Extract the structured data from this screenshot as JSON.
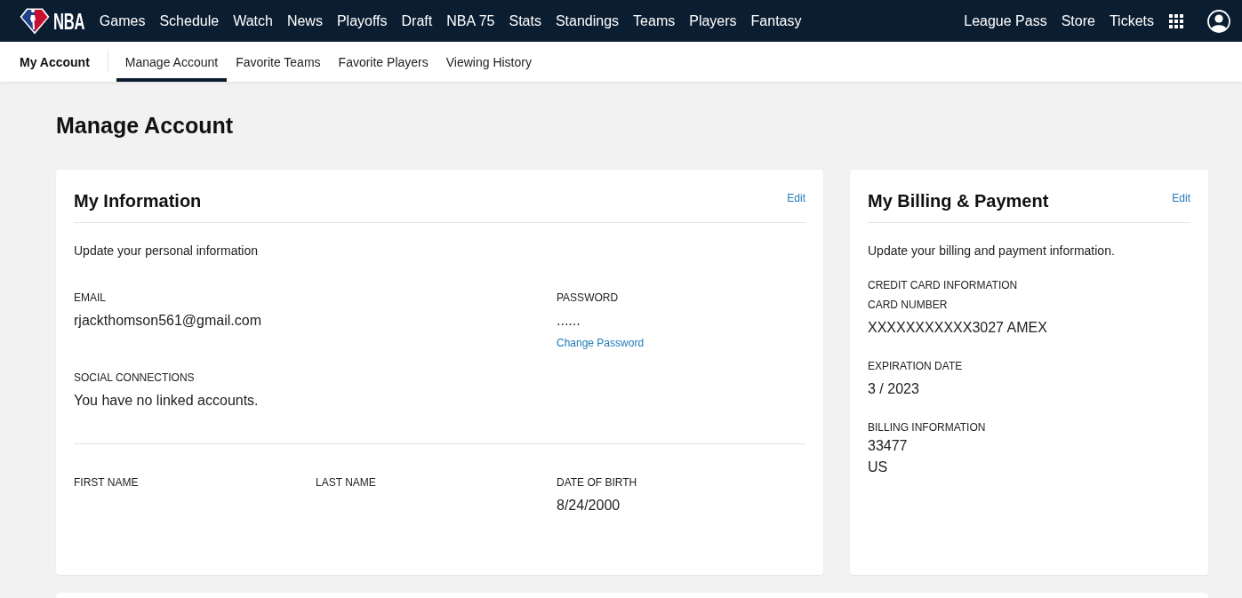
{
  "top_nav": {
    "logo_text": "NBA",
    "links": [
      "Games",
      "Schedule",
      "Watch",
      "News",
      "Playoffs",
      "Draft",
      "NBA 75",
      "Stats",
      "Standings",
      "Teams",
      "Players",
      "Fantasy"
    ],
    "right_links": [
      "League Pass",
      "Store",
      "Tickets"
    ]
  },
  "sub_nav": {
    "title": "My Account",
    "tabs": [
      {
        "label": "Manage Account",
        "selected": true
      },
      {
        "label": "Favorite Teams",
        "selected": false
      },
      {
        "label": "Favorite Players",
        "selected": false
      },
      {
        "label": "Viewing History",
        "selected": false
      }
    ]
  },
  "page_title": "Manage Account",
  "info_card": {
    "title": "My Information",
    "edit_link": "Edit",
    "description": "Update your personal information",
    "sections": [
      {
        "columns": [
          [
            {
              "label": "EMAIL",
              "value": "rjackthomson561@gmail.com"
            },
            {
              "label": "SOCIAL CONNECTIONS",
              "value": "You have no linked accounts."
            }
          ],
          [
            {
              "label": "PASSWORD",
              "value": "......",
              "link": "Change Password"
            }
          ]
        ]
      },
      {
        "columns": [
          [
            {
              "label": "FIRST NAME"
            }
          ],
          [
            {
              "label": "LAST NAME"
            }
          ],
          [
            {
              "label": "DATE OF BIRTH",
              "value": "8/24/2000"
            }
          ]
        ]
      }
    ]
  },
  "billing_card": {
    "title": "My Billing & Payment",
    "edit_link": "Edit",
    "description": "Update your billing and payment information.",
    "heading": "CREDIT CARD INFORMATION",
    "fields": [
      {
        "label": "CARD NUMBER",
        "value": "XXXXXXXXXXX3027 AMEX"
      },
      {
        "label": "EXPIRATION DATE",
        "value": "3 / 2023"
      },
      {
        "label": "BILLING INFORMATION",
        "lines": [
          "33477",
          "US"
        ]
      }
    ]
  }
}
